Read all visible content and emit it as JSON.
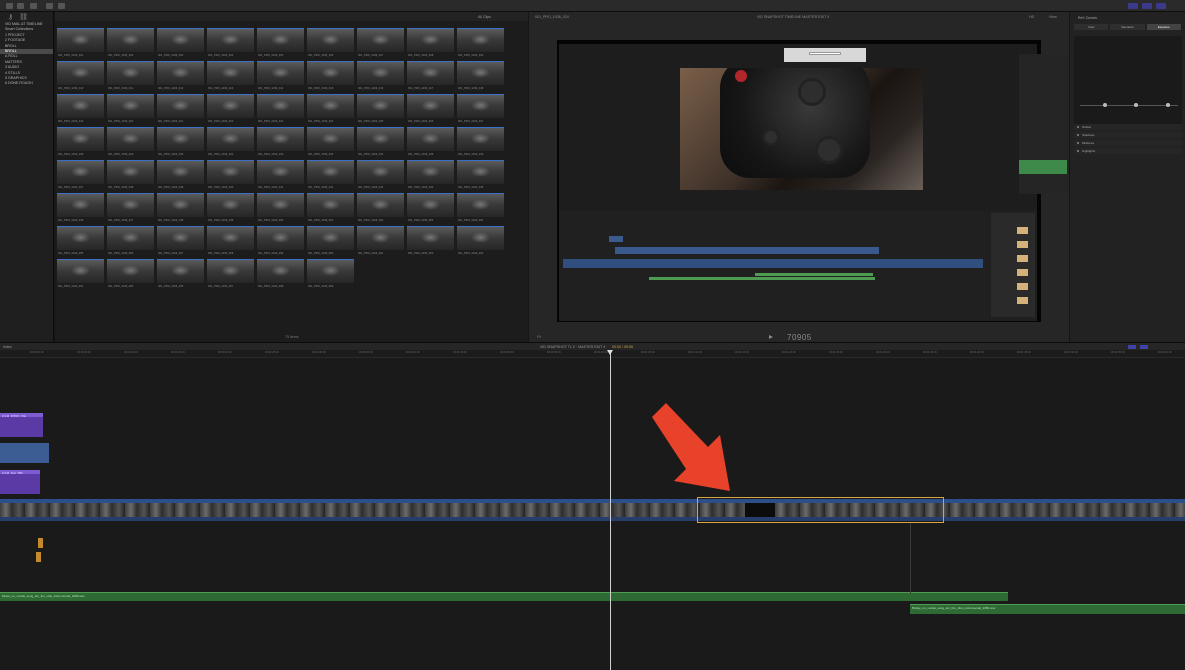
{
  "app": {
    "accent": "#3e43a8",
    "icons": [
      "key-icon",
      "link-icon",
      "import-icon",
      "keyword-icon",
      "background-tasks-icon"
    ]
  },
  "sidebar": {
    "items": [
      {
        "label": "VID MAIL AT TIMELINE",
        "selected": false
      },
      {
        "label": "Smart Collections",
        "selected": false
      },
      {
        "label": "1 PROJECT",
        "selected": false
      },
      {
        "label": "2 FOOTAGE",
        "selected": false
      },
      {
        "label": "BROLL",
        "selected": false
      },
      {
        "label": "BROLL",
        "selected": true
      },
      {
        "label": "A ROLL",
        "selected": false
      },
      {
        "label": "MATTERS",
        "selected": false
      },
      {
        "label": "3 AUDIO",
        "selected": false
      },
      {
        "label": "4 STILLS",
        "selected": false
      },
      {
        "label": "5 GRAPHICS",
        "selected": false
      },
      {
        "label": "6 DONE ROUGH",
        "selected": false
      }
    ]
  },
  "browser": {
    "filter_label": "All Clips",
    "clip_count": "75 items",
    "clips": [
      "001_PRO_1036_001",
      "001_PRO_1036_002",
      "001_PRO_1036_003",
      "001_PRO_1036_004",
      "001_PRO_1036_005",
      "001_PRO_1036_006",
      "001_PRO_1036_007",
      "001_PRO_1036_008",
      "001_PRO_1036_009",
      "001_PRO_1036_010",
      "001_PRO_1036_011",
      "001_PRO_1036_012",
      "001_PRO_1036_013",
      "001_PRO_1036_014",
      "001_PRO_1036_015",
      "001_PRO_1036_016",
      "001_PRO_1036_017",
      "001_PRO_1036_018",
      "001_PRO_1036_019",
      "001_PRO_1036_020",
      "001_PRO_1036_021",
      "001_PRO_1036_022",
      "001_PRO_1036_023",
      "001_PRO_1036_024",
      "001_PRO_1036_025",
      "001_PRO_1036_026",
      "001_PRO_1036_027",
      "001_PRO_1036_028",
      "001_PRO_1036_029",
      "001_PRO_1036_030",
      "001_PRO_1036_031",
      "001_PRO_1036_032",
      "001_PRO_1036_033",
      "001_PRO_1036_034",
      "001_PRO_1036_035",
      "001_PRO_1036_036",
      "001_PRO_1036_037",
      "001_PRO_1036_038",
      "001_PRO_1036_039",
      "001_PRO_1036_040",
      "001_PRO_1036_041",
      "001_PRO_1036_042",
      "001_PRO_1036_043",
      "001_PRO_1036_044",
      "001_PRO_1036_045",
      "001_PRO_1036_046",
      "001_PRO_1036_047",
      "001_PRO_1036_048",
      "001_PRO_1036_049",
      "001_PRO_1036_050",
      "001_PRO_1036_051",
      "001_PRO_1036_052",
      "001_PRO_1036_053",
      "001_PRO_1036_054",
      "001_PRO_1036_055",
      "001_PRO_1036_056",
      "001_PRO_1036_057",
      "001_PRO_1036_058",
      "001_PRO_1036_059",
      "001_PRO_1036_060",
      "001_PRO_1036_061",
      "001_PRO_1036_062",
      "001_PRO_1036_063",
      "001_PRO_1036_064",
      "001_PRO_1036_065",
      "001_PRO_1036_066",
      "001_PRO_1036_067",
      "001_PRO_1036_068",
      "001_PRO_1036_069"
    ]
  },
  "viewer": {
    "clip_name": "001_PRO_1036_024",
    "project_name": "VID SNAPSHOT TIMELINE MASTER EDIT 4",
    "format": "HD",
    "view_label": "View",
    "zoom_label": "Fit",
    "timecode": "70905"
  },
  "inspector": {
    "title": "Ref: Curves",
    "tabs": [
      {
        "label": "Color",
        "selected": false
      },
      {
        "label": "Saturation",
        "selected": false
      },
      {
        "label": "Exposure",
        "selected": true
      }
    ],
    "rows": [
      "Global",
      "Shadows",
      "Midtones",
      "Highlights"
    ],
    "nodes": [
      0.25,
      0.57,
      0.9
    ]
  },
  "timeline": {
    "index_label": "Index",
    "project_label": "VID SNAPSHOT TL V · MASTER EDIT 4",
    "duration_label": "00:00 / 09:55",
    "ruler": [
      "00:00:00:00",
      "00:00:05:00",
      "00:00:10:00",
      "00:00:15:00",
      "00:00:20:00",
      "00:00:25:00",
      "00:00:30:00",
      "00:00:35:00",
      "00:00:40:00",
      "00:00:45:00",
      "00:00:50:00",
      "00:00:55:00",
      "00:01:00:00",
      "00:01:05:00",
      "00:01:10:00",
      "00:01:15:00",
      "00:01:20:00",
      "00:01:25:00",
      "00:01:30:00",
      "00:01:35:00",
      "00:01:40:00",
      "00:01:45:00",
      "00:01:50:00",
      "00:01:55:00",
      "00:02:00:00"
    ],
    "titles": [
      "2:3-M_INTRO_Title",
      "2:3-M_Text_TBC"
    ],
    "audio_tracks": [
      "Music_no_vocals_song_am_the_vibe_instrumental_1080.wav",
      "Bridge_no_vocals_song_am_the_vibe_instrumental_1080.wav"
    ],
    "selection_color": "#d8a640",
    "annotation_color": "#e8422a"
  }
}
